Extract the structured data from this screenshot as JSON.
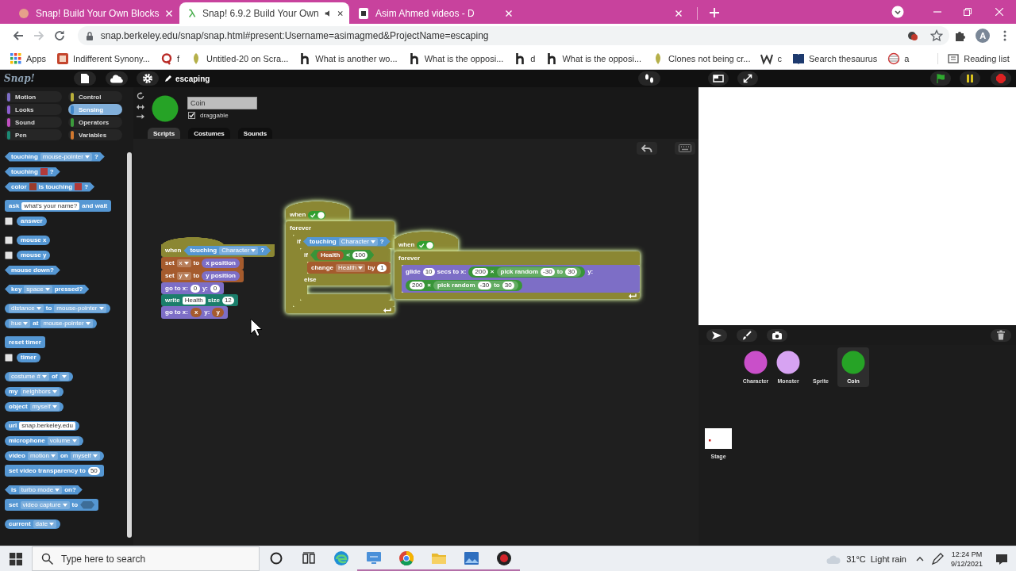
{
  "browser": {
    "tabs": [
      {
        "kind": "snap",
        "title": "Snap! Build Your Own Blocks",
        "selected": false,
        "audio": false
      },
      {
        "kind": "lambda",
        "title": "Snap! 6.9.2 Build Your Own",
        "selected": true,
        "audio": true
      },
      {
        "kind": "page",
        "title": "Asim Ahmed videos - D",
        "selected": false,
        "audio": false
      },
      {
        "selected": false,
        "audio": false
      }
    ],
    "url": "snap.berkeley.edu/snap/snap.html#present:Username=asimagmed&ProjectName=escaping",
    "profile_initial": "A",
    "bookmarks": [
      {
        "kind": "apps",
        "label": "Apps"
      },
      {
        "kind": "tile",
        "label": "Indifferent Synony..."
      },
      {
        "kind": "ring",
        "label": "f"
      },
      {
        "kind": "leaf",
        "label": "Untitled-20 on Scra..."
      },
      {
        "kind": "h",
        "label": "What is another wo..."
      },
      {
        "kind": "h",
        "label": "What is the opposi..."
      },
      {
        "kind": "h",
        "label": "d"
      },
      {
        "kind": "h",
        "label": "What is the opposi..."
      },
      {
        "kind": "leaf",
        "label": "Clones not being cr..."
      },
      {
        "kind": "w",
        "label": "c"
      },
      {
        "kind": "book",
        "label": "Search thesaurus"
      },
      {
        "kind": "globe",
        "label": "a"
      }
    ],
    "reading_list": "Reading list"
  },
  "snap": {
    "logo": "Snap!",
    "project_name": "escaping",
    "categories": [
      {
        "label": "Motion",
        "color": "#7d6ec6",
        "selected": false
      },
      {
        "label": "Control",
        "color": "#b8ae3a",
        "selected": false
      },
      {
        "label": "Looks",
        "color": "#8d5fd0",
        "selected": false
      },
      {
        "label": "Sensing",
        "color": "#3f86c8",
        "selected": true
      },
      {
        "label": "Sound",
        "color": "#c04fc0",
        "selected": false
      },
      {
        "label": "Operators",
        "color": "#3b9b3b",
        "selected": false
      },
      {
        "label": "Pen",
        "color": "#1b8a74",
        "selected": false
      },
      {
        "label": "Variables",
        "color": "#d0782f",
        "selected": false
      }
    ],
    "palette": [
      [
        {
          "kind": "predicate",
          "color": "#5597d3",
          "parts": [
            {
              "kind": "label",
              "text": "touching"
            },
            {
              "kind": "menu",
              "text": "mouse-pointer"
            },
            {
              "kind": "label",
              "text": "?"
            }
          ]
        },
        {
          "kind": "predicate",
          "color": "#5597d3",
          "parts": [
            {
              "kind": "label",
              "text": "touching"
            },
            {
              "kind": "color",
              "color": "#b23a3a"
            },
            {
              "kind": "label",
              "text": "?"
            }
          ]
        },
        {
          "kind": "predicate",
          "color": "#5597d3",
          "parts": [
            {
              "kind": "label",
              "text": "color"
            },
            {
              "kind": "color",
              "color": "#9a3b2b"
            },
            {
              "kind": "label",
              "text": "is touching"
            },
            {
              "kind": "color",
              "color": "#b23a3a"
            },
            {
              "kind": "label",
              "text": "?"
            }
          ]
        }
      ],
      [
        {
          "kind": "command",
          "color": "#5597d3",
          "parts": [
            {
              "kind": "label",
              "text": "ask"
            },
            {
              "kind": "text",
              "text": "what's your name?"
            },
            {
              "kind": "label",
              "text": "and wait"
            }
          ]
        },
        {
          "checked": false,
          "kind": "reporter",
          "color": "#5597d3",
          "parts": [
            {
              "kind": "label",
              "text": "answer"
            }
          ]
        }
      ],
      [
        {
          "checked": false,
          "kind": "reporter",
          "color": "#5597d3",
          "parts": [
            {
              "kind": "label",
              "text": "mouse x"
            }
          ]
        },
        {
          "checked": false,
          "kind": "reporter",
          "color": "#5597d3",
          "parts": [
            {
              "kind": "label",
              "text": "mouse y"
            }
          ]
        },
        {
          "kind": "predicate",
          "color": "#5597d3",
          "parts": [
            {
              "kind": "label",
              "text": "mouse down?"
            }
          ]
        }
      ],
      [
        {
          "kind": "predicate",
          "color": "#5597d3",
          "parts": [
            {
              "kind": "label",
              "text": "key"
            },
            {
              "kind": "menu",
              "text": "space"
            },
            {
              "kind": "label",
              "text": "pressed?"
            }
          ]
        }
      ],
      [
        {
          "kind": "reporter",
          "color": "#5597d3",
          "parts": [
            {
              "kind": "menu",
              "text": "distance"
            },
            {
              "kind": "label",
              "text": "to"
            },
            {
              "kind": "menu",
              "text": "mouse-pointer"
            }
          ]
        },
        {
          "kind": "reporter",
          "color": "#5597d3",
          "parts": [
            {
              "kind": "menu",
              "text": "hue"
            },
            {
              "kind": "label",
              "text": "at"
            },
            {
              "kind": "menu",
              "text": "mouse-pointer"
            }
          ]
        }
      ],
      [
        {
          "kind": "command",
          "color": "#5597d3",
          "parts": [
            {
              "kind": "label",
              "text": "reset timer"
            }
          ]
        },
        {
          "checked": false,
          "kind": "reporter",
          "color": "#5597d3",
          "parts": [
            {
              "kind": "label",
              "text": "timer"
            }
          ]
        }
      ],
      [
        {
          "kind": "reporter",
          "color": "#5597d3",
          "parts": [
            {
              "kind": "menu",
              "text": "costume #"
            },
            {
              "kind": "label",
              "text": "of"
            },
            {
              "kind": "menu"
            }
          ]
        },
        {
          "kind": "reporter",
          "color": "#5597d3",
          "parts": [
            {
              "kind": "label",
              "text": "my"
            },
            {
              "kind": "menu",
              "text": "neighbors"
            }
          ]
        },
        {
          "kind": "reporter",
          "color": "#5597d3",
          "parts": [
            {
              "kind": "label",
              "text": "object"
            },
            {
              "kind": "menu",
              "text": "myself"
            }
          ]
        }
      ],
      [
        {
          "kind": "reporter",
          "color": "#5597d3",
          "parts": [
            {
              "kind": "label",
              "text": "url"
            },
            {
              "kind": "text",
              "text": "snap.berkeley.edu"
            }
          ]
        },
        {
          "kind": "reporter",
          "color": "#5597d3",
          "parts": [
            {
              "kind": "label",
              "text": "microphone"
            },
            {
              "kind": "menu",
              "text": "volume"
            }
          ]
        },
        {
          "kind": "reporter",
          "color": "#5597d3",
          "parts": [
            {
              "kind": "label",
              "text": "video"
            },
            {
              "kind": "menu",
              "text": "motion"
            },
            {
              "kind": "label",
              "text": "on"
            },
            {
              "kind": "menu",
              "text": "myself"
            }
          ]
        },
        {
          "kind": "command",
          "color": "#5597d3",
          "parts": [
            {
              "kind": "label",
              "text": "set video transparency to"
            },
            {
              "kind": "number",
              "text": "50"
            }
          ]
        }
      ],
      [
        {
          "kind": "predicate",
          "color": "#5597d3",
          "parts": [
            {
              "kind": "label",
              "text": "is"
            },
            {
              "kind": "menu",
              "text": "turbo mode"
            },
            {
              "kind": "label",
              "text": "on?"
            }
          ]
        },
        {
          "kind": "command",
          "color": "#5597d3",
          "parts": [
            {
              "kind": "label",
              "text": "set"
            },
            {
              "kind": "menu",
              "text": "video capture"
            },
            {
              "kind": "label",
              "text": "to"
            },
            {
              "kind": "bool"
            }
          ]
        }
      ],
      [
        {
          "kind": "reporter",
          "color": "#5597d3",
          "parts": [
            {
              "kind": "label",
              "text": "current"
            },
            {
              "kind": "menu",
              "text": "date"
            }
          ]
        }
      ]
    ],
    "sprite": {
      "name": "Coin",
      "color": "#26a326",
      "draggable": true,
      "draggable_label": "draggable",
      "tabs": [
        {
          "label": "Scripts",
          "selected": true
        },
        {
          "label": "Costumes",
          "selected": false
        },
        {
          "label": "Sounds",
          "selected": false
        }
      ]
    },
    "scripts": [
      {
        "running": false,
        "blocks": [
          {
            "kind": "hat",
            "color": "#8b8733",
            "parts": [
              {
                "kind": "label",
                "text": "when"
              },
              {
                "kind": "block",
                "block": {
                  "kind": "predicate",
                  "color": "#5597d3",
                  "parts": [
                    {
                      "kind": "label",
                      "text": "touching"
                    },
                    {
                      "kind": "menu",
                      "text": "Character"
                    },
                    {
                      "kind": "label",
                      "text": "?"
                    }
                  ]
                }
              }
            ]
          },
          {
            "kind": "command",
            "color": "#a55b2d",
            "parts": [
              {
                "kind": "label",
                "text": "set"
              },
              {
                "kind": "menu",
                "text": "x"
              },
              {
                "kind": "label",
                "text": "to"
              },
              {
                "kind": "block",
                "block": {
                  "kind": "reporter",
                  "color": "#7d6ec6",
                  "parts": [
                    {
                      "kind": "label",
                      "text": "x position"
                    }
                  ]
                }
              }
            ]
          },
          {
            "kind": "command",
            "color": "#a55b2d",
            "parts": [
              {
                "kind": "label",
                "text": "set"
              },
              {
                "kind": "menu",
                "text": "y"
              },
              {
                "kind": "label",
                "text": "to"
              },
              {
                "kind": "block",
                "block": {
                  "kind": "reporter",
                  "color": "#7d6ec6",
                  "parts": [
                    {
                      "kind": "label",
                      "text": "y position"
                    }
                  ]
                }
              }
            ]
          },
          {
            "kind": "command",
            "color": "#7d6ec6",
            "parts": [
              {
                "kind": "label",
                "text": "go to x:"
              },
              {
                "kind": "number",
                "text": "0"
              },
              {
                "kind": "label",
                "text": "y:"
              },
              {
                "kind": "number",
                "text": "0"
              }
            ]
          },
          {
            "kind": "command",
            "color": "#1b7e6b",
            "parts": [
              {
                "kind": "label",
                "text": "write"
              },
              {
                "kind": "text",
                "text": "Health"
              },
              {
                "kind": "label",
                "text": "size"
              },
              {
                "kind": "number",
                "text": "12"
              }
            ]
          },
          {
            "kind": "command",
            "color": "#7d6ec6",
            "parts": [
              {
                "kind": "label",
                "text": "go to x:"
              },
              {
                "kind": "block",
                "block": {
                  "kind": "reporter",
                  "color": "#a55b2d",
                  "parts": [
                    {
                      "kind": "label",
                      "text": "x"
                    }
                  ]
                }
              },
              {
                "kind": "label",
                "text": "y:"
              },
              {
                "kind": "block",
                "block": {
                  "kind": "reporter",
                  "color": "#a55b2d",
                  "parts": [
                    {
                      "kind": "label",
                      "text": "y"
                    }
                  ]
                }
              }
            ]
          }
        ]
      },
      {
        "running": true,
        "blocks": [
          {
            "kind": "hat",
            "color": "#8b8733",
            "parts": [
              {
                "kind": "label",
                "text": "when"
              },
              {
                "kind": "toggle",
                "on": true
              }
            ]
          },
          {
            "kind": "c",
            "color": "#8b8733",
            "loop": true,
            "parts": [
              {
                "kind": "label",
                "text": "forever"
              }
            ],
            "body": [
              {
                "kind": "c",
                "color": "#8b8733",
                "parts": [
                  {
                    "kind": "label",
                    "text": "if"
                  },
                  {
                    "kind": "block",
                    "block": {
                      "kind": "predicate",
                      "color": "#5597d3",
                      "parts": [
                        {
                          "kind": "label",
                          "text": "touching"
                        },
                        {
                          "kind": "menu",
                          "text": "Character"
                        },
                        {
                          "kind": "label",
                          "text": "?"
                        }
                      ]
                    }
                  }
                ],
                "body": [
                  {
                    "kind": "c",
                    "color": "#8b8733",
                    "parts": [
                      {
                        "kind": "label",
                        "text": "if"
                      },
                      {
                        "kind": "block",
                        "block": {
                          "kind": "predicate",
                          "color": "#389538",
                          "parts": [
                            {
                              "kind": "block",
                              "block": {
                                "kind": "reporter",
                                "color": "#a55b2d",
                                "parts": [
                                  {
                                    "kind": "label",
                                    "text": "Health"
                                  }
                                ]
                              }
                            },
                            {
                              "kind": "label",
                              "text": "<"
                            },
                            {
                              "kind": "number",
                              "text": "100"
                            }
                          ]
                        }
                      }
                    ],
                    "body": [
                      {
                        "kind": "command",
                        "color": "#a55b2d",
                        "parts": [
                          {
                            "kind": "label",
                            "text": "change"
                          },
                          {
                            "kind": "menu",
                            "text": "Health"
                          },
                          {
                            "kind": "label",
                            "text": "by"
                          },
                          {
                            "kind": "number",
                            "text": "1"
                          }
                        ]
                      }
                    ],
                    "else_parts": [
                      {
                        "kind": "label",
                        "text": "else"
                      }
                    ]
                  }
                ]
              }
            ]
          }
        ]
      },
      {
        "running": true,
        "blocks": [
          {
            "kind": "hat",
            "color": "#8b8733",
            "parts": [
              {
                "kind": "label",
                "text": "when"
              },
              {
                "kind": "toggle",
                "on": true
              }
            ]
          },
          {
            "kind": "c",
            "color": "#8b8733",
            "loop": true,
            "parts": [
              {
                "kind": "label",
                "text": "forever"
              }
            ],
            "body": [
              {
                "kind": "command",
                "color": "#7d6ec6",
                "parts": [
                  {
                    "kind": "label",
                    "text": "glide"
                  },
                  {
                    "kind": "number",
                    "text": "10"
                  },
                  {
                    "kind": "label",
                    "text": "secs to x:"
                  },
                  {
                    "kind": "block",
                    "block": {
                      "kind": "reporter",
                      "color": "#389538",
                      "parts": [
                        {
                          "kind": "number",
                          "text": "200"
                        },
                        {
                          "kind": "label",
                          "text": "×"
                        },
                        {
                          "kind": "block",
                          "block": {
                            "kind": "reporter",
                            "color": "#64ac64",
                            "parts": [
                              {
                                "kind": "label",
                                "text": "pick random"
                              },
                              {
                                "kind": "number",
                                "text": "-30"
                              },
                              {
                                "kind": "label",
                                "text": "to"
                              },
                              {
                                "kind": "number",
                                "text": "30"
                              }
                            ]
                          }
                        }
                      ]
                    }
                  },
                  {
                    "kind": "label",
                    "text": "y:"
                  },
                  {
                    "kind": "block",
                    "block": {
                      "kind": "reporter",
                      "color": "#389538",
                      "parts": [
                        {
                          "kind": "number",
                          "text": "200"
                        },
                        {
                          "kind": "label",
                          "text": "×"
                        },
                        {
                          "kind": "block",
                          "block": {
                            "kind": "reporter",
                            "color": "#64ac64",
                            "parts": [
                              {
                                "kind": "label",
                                "text": "pick random"
                              },
                              {
                                "kind": "number",
                                "text": "-30"
                              },
                              {
                                "kind": "label",
                                "text": "to"
                              },
                              {
                                "kind": "number",
                                "text": "30"
                              }
                            ]
                          }
                        }
                      ]
                    }
                  }
                ]
              }
            ]
          }
        ]
      }
    ],
    "corral": {
      "sprites": [
        {
          "name": "Character",
          "color": "#c94fc9",
          "selected": false
        },
        {
          "name": "Monster",
          "color": "#d7a3f2",
          "selected": false
        },
        {
          "name": "Sprite",
          "selected": false
        },
        {
          "name": "Coin",
          "color": "#26a326",
          "selected": true
        }
      ],
      "stage_label": "Stage"
    }
  },
  "taskbar": {
    "search_placeholder": "Type here to search",
    "apps": [
      {
        "kind": "swirl",
        "running": false
      },
      {
        "kind": "monitor",
        "running": true
      },
      {
        "kind": "wheel",
        "running": true
      },
      {
        "kind": "folder",
        "running": true
      },
      {
        "kind": "landscape",
        "running": true
      },
      {
        "kind": "record",
        "running": true
      }
    ],
    "temperature": "31°C",
    "weather": "Light rain",
    "time": "12:24 PM",
    "date": "9/12/2021"
  }
}
